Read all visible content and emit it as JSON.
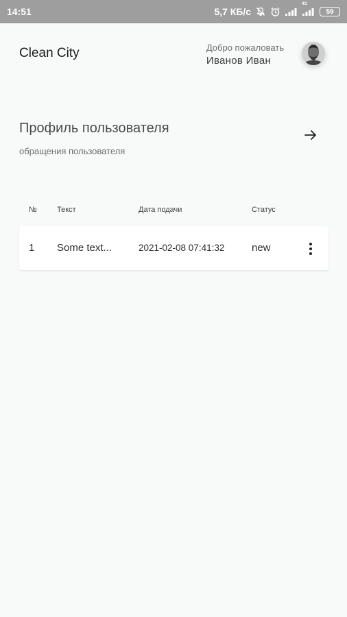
{
  "status_bar": {
    "time": "14:51",
    "net_speed": "5,7 КБ/с",
    "battery": "59",
    "network_label": "4G"
  },
  "header": {
    "brand": "Clean City",
    "welcome": "Добро пожаловать",
    "user_name": "Иванов Иван"
  },
  "profile": {
    "title": "Профиль пользователя",
    "subtitle": "обращения пользователя"
  },
  "table": {
    "columns": [
      "№",
      "Текст",
      "Дата подачи",
      "Статус"
    ],
    "rows": [
      {
        "num": "1",
        "text": "Some text...",
        "date": "2021-02-08 07:41:32",
        "status": "new"
      }
    ]
  }
}
